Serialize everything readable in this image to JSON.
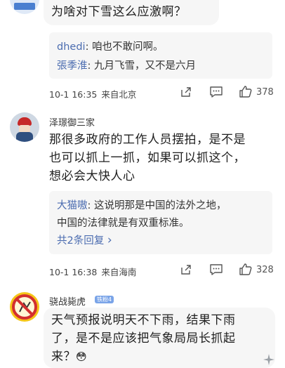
{
  "comments": [
    {
      "body": "为啥对下雪这么应激啊？",
      "replies": [
        {
          "name": "dhedi",
          "sep": ": ",
          "text": "咱也不敢问啊。"
        },
        {
          "name": "張季淮",
          "sep": ": ",
          "text": "九月飞雪，又不是六月"
        }
      ],
      "time": "10-1 16:35",
      "location": "来自北京",
      "likes": "378"
    },
    {
      "username": "泽璟御三家",
      "body_lines": [
        "那很多政府的工作人员摆拍，是不是",
        "也可以抓上一抓，如果可以抓这个，",
        "想必会大快人心"
      ],
      "reply": {
        "name": "大猫嗷",
        "sep": ": ",
        "lines": [
          "这说明那是中国的法外之地，",
          "中国的法律就是有双重标准。"
        ]
      },
      "more_replies": "共2条回复",
      "more_arrow": "›",
      "time": "10-1 16:38",
      "location": "来自海南",
      "likes": "328"
    },
    {
      "username": "骁战毙虎",
      "badge": "铁粉4",
      "body_lines": [
        "天气预报说明天不下雨，结果下雨",
        "了，是不是应该把气象局局长抓起",
        "来？"
      ],
      "emoji": "😳"
    }
  ],
  "icons": {
    "share": "share-icon",
    "comment": "comment-icon",
    "like": "thumbs-up-icon"
  }
}
